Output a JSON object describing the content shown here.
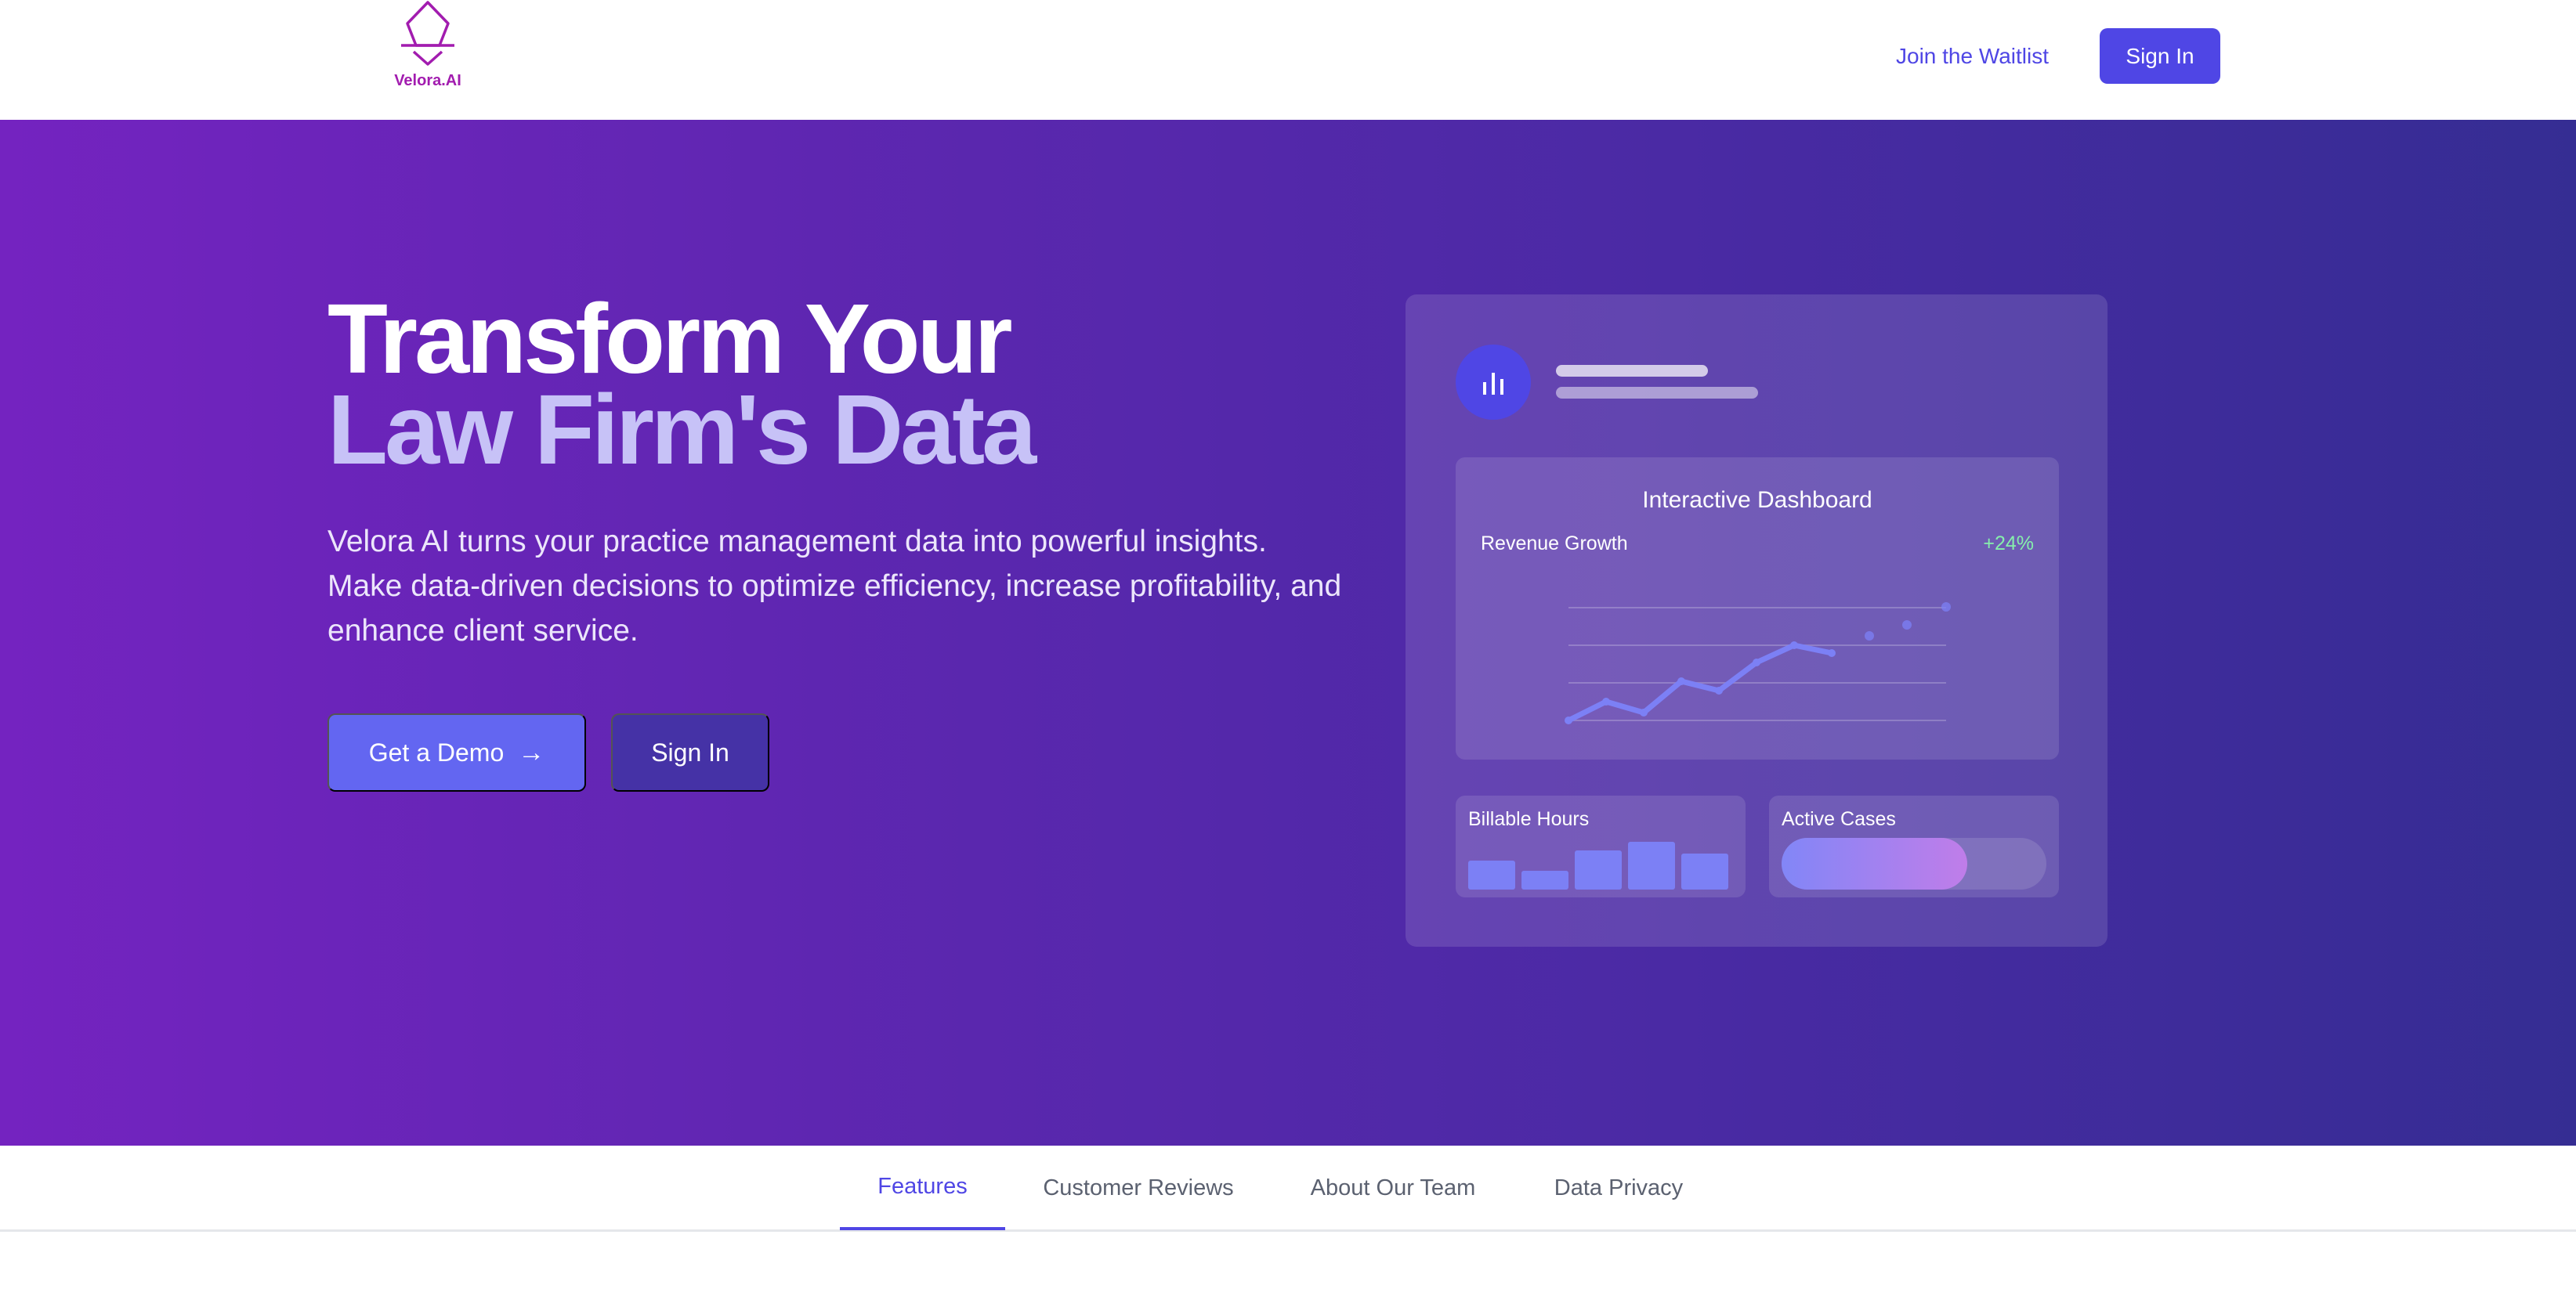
{
  "header": {
    "logo_text": "Velora.AI",
    "waitlist_label": "Join the Waitlist",
    "signin_label": "Sign In"
  },
  "hero": {
    "title_line1": "Transform Your",
    "title_line2": "Law Firm's Data",
    "subtitle": "Velora AI turns your practice management data into powerful insights. Make data-driven decisions to optimize efficiency, increase profitability, and enhance client service.",
    "demo_label": "Get a Demo",
    "demo_icon": "arrow-right-icon",
    "signin_label": "Sign In"
  },
  "dashboard": {
    "avatar_icon": "bar-chart-icon",
    "chart_title": "Interactive Dashboard",
    "revenue_label": "Revenue Growth",
    "revenue_change": "+24%",
    "billable_label": "Billable Hours",
    "billable_bars": [
      0.58,
      0.38,
      0.78,
      0.95,
      0.72
    ],
    "active_cases_label": "Active Cases",
    "active_cases_fill": 0.7
  },
  "tabs": [
    {
      "label": "Features",
      "active": true
    },
    {
      "label": "Customer Reviews",
      "active": false
    },
    {
      "label": "About Our Team",
      "active": false
    },
    {
      "label": "Data Privacy",
      "active": false
    }
  ],
  "colors": {
    "accent": "#4f46e5",
    "hero_start": "#7423c0",
    "hero_end": "#352d93",
    "positive": "#86efac",
    "logo": "#a21caf"
  }
}
